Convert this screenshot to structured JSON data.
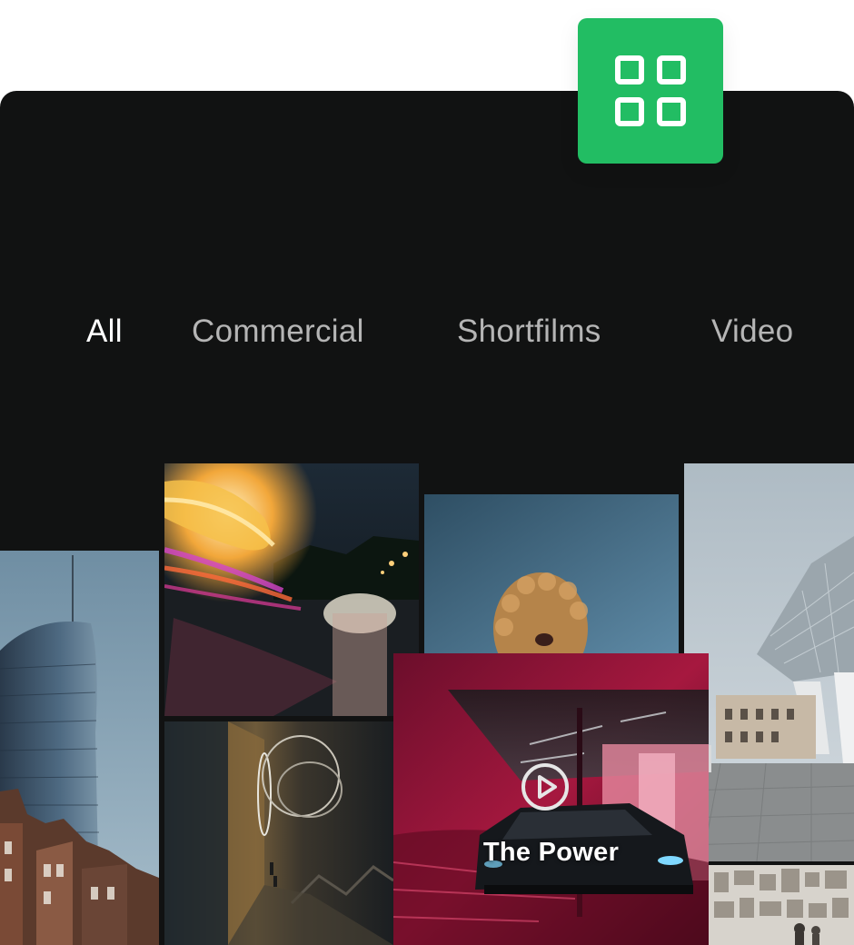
{
  "app_badge": {
    "icon": "grid-icon",
    "color": "#22bd63"
  },
  "filters": {
    "active": "All",
    "items": [
      {
        "label": "All"
      },
      {
        "label": "Commercial"
      },
      {
        "label": "Shortfilms"
      },
      {
        "label": "Video"
      }
    ]
  },
  "gallery": {
    "featured": {
      "title": "The Power",
      "icon": "play-icon"
    },
    "tiles": [
      {
        "subject": "skyscraper"
      },
      {
        "subject": "neon-light-trails"
      },
      {
        "subject": "curly-hair-portrait"
      },
      {
        "subject": "glass-building"
      },
      {
        "subject": "dark-corridor-rings"
      },
      {
        "subject": "car-red-garage"
      },
      {
        "subject": "photo-wall"
      }
    ]
  },
  "colors": {
    "background": "#111212",
    "accent": "#22bd63",
    "tab_inactive": "#b5b5b5",
    "tab_active": "#ffffff"
  }
}
